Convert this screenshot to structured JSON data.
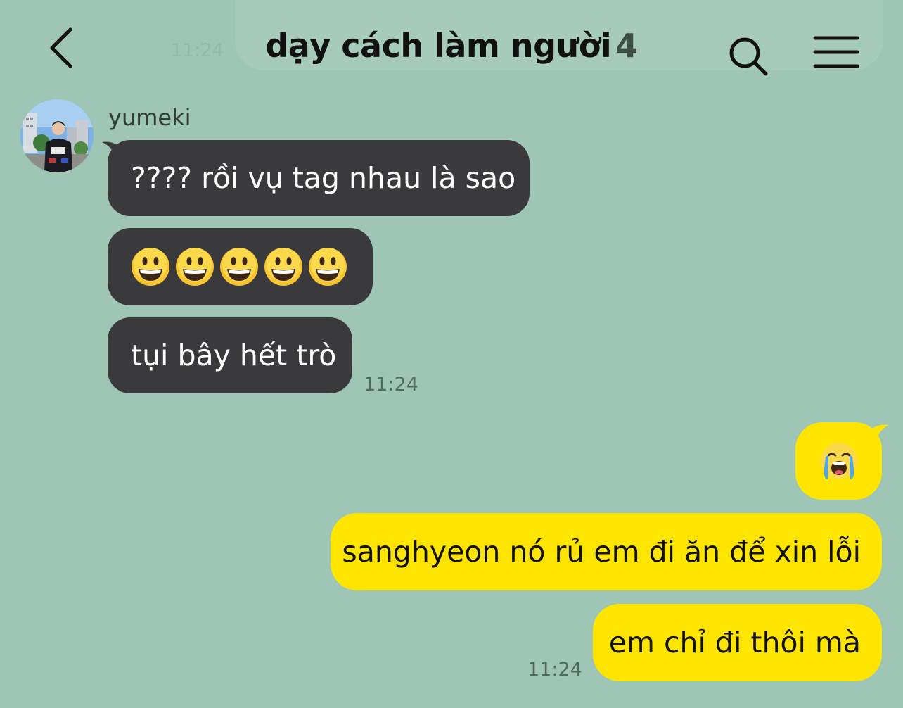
{
  "header": {
    "title": "dạy cách làm người",
    "member_count": "4",
    "background_time": "11:24"
  },
  "icons": {
    "back": "chevron-left-icon",
    "search": "search-icon",
    "menu": "hamburger-menu-icon"
  },
  "colors": {
    "chat_background": "#9fc6b5",
    "incoming_bubble": "#3a3a3c",
    "outgoing_bubble": "#fee500"
  },
  "incoming": {
    "sender": "yumeki",
    "messages": [
      {
        "text": "???? rồi vụ tag nhau là sao"
      },
      {
        "emoji": "grinning-face",
        "count": 5
      },
      {
        "text": "tụi bây hết trò"
      }
    ],
    "time": "11:24"
  },
  "outgoing": {
    "messages": [
      {
        "emoji": "loudly-crying-face"
      },
      {
        "text": "sanghyeon nó rủ em đi ăn để xin lỗi"
      },
      {
        "text": "em chỉ đi thôi mà"
      }
    ],
    "time": "11:24"
  }
}
